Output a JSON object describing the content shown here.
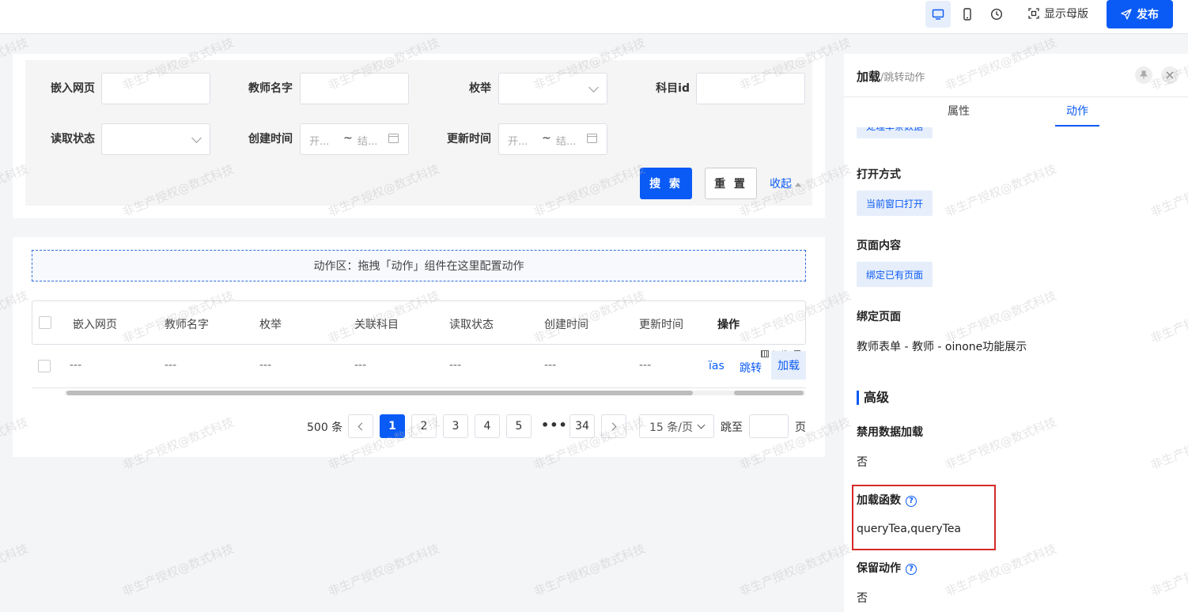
{
  "toolbar": {
    "device_desktop_icon": "desktop-icon",
    "device_mobile_icon": "mobile-icon",
    "history_icon": "clock-icon",
    "show_master": "显示母版",
    "publish": "发布"
  },
  "search": {
    "fields": [
      {
        "label": "嵌入网页"
      },
      {
        "label": "教师名字"
      },
      {
        "label": "枚举"
      },
      {
        "label": "科目id"
      },
      {
        "label": "读取状态"
      },
      {
        "label": "创建时间",
        "start_placeholder": "开...",
        "sep": "~",
        "end_placeholder": "结..."
      },
      {
        "label": "更新时间",
        "start_placeholder": "开...",
        "sep": "~",
        "end_placeholder": "结..."
      }
    ],
    "search_btn": "搜 索",
    "reset_btn": "重 置",
    "collapse_btn": "收起"
  },
  "table": {
    "action_zone": "动作区：拖拽「动作」组件在这里配置动作",
    "columns": [
      "嵌入网页",
      "教师名字",
      "枚举",
      "关联科目",
      "读取状态",
      "创建时间",
      "更新时间",
      "操作"
    ],
    "row": [
      "---",
      "---",
      "---",
      "---",
      "---",
      "---",
      "---"
    ],
    "row_actions": {
      "partial": "ïas",
      "jump": "跳转",
      "load": "加载"
    },
    "mini_tool_label": "加载"
  },
  "pagination": {
    "total": "500 条",
    "pages": [
      "1",
      "2",
      "3",
      "4",
      "5"
    ],
    "ellipsis": "•••",
    "last": "34",
    "current": "1",
    "page_size": "15 条/页",
    "goto_label": "跳至",
    "page_label": "页"
  },
  "panel": {
    "title_main": "加载",
    "title_sub": "/跳转动作",
    "tabs": [
      "属性",
      "动作"
    ],
    "active_tab": "动作",
    "cut_chip": "处理单条数据",
    "open_mode_label": "打开方式",
    "open_mode_value": "当前窗口打开",
    "page_content_label": "页面内容",
    "page_content_value": "绑定已有页面",
    "bind_page_label": "绑定页面",
    "bind_page_value": "教师表单 - 教师 - oinone功能展示",
    "advanced_label": "高级",
    "disable_load_label": "禁用数据加载",
    "disable_load_value": "否",
    "load_func_label": "加载函数",
    "load_func_value": "queryTea,queryTea",
    "keep_action_label": "保留动作",
    "keep_action_value": "否"
  },
  "watermark": "非生产授权@数式科技"
}
